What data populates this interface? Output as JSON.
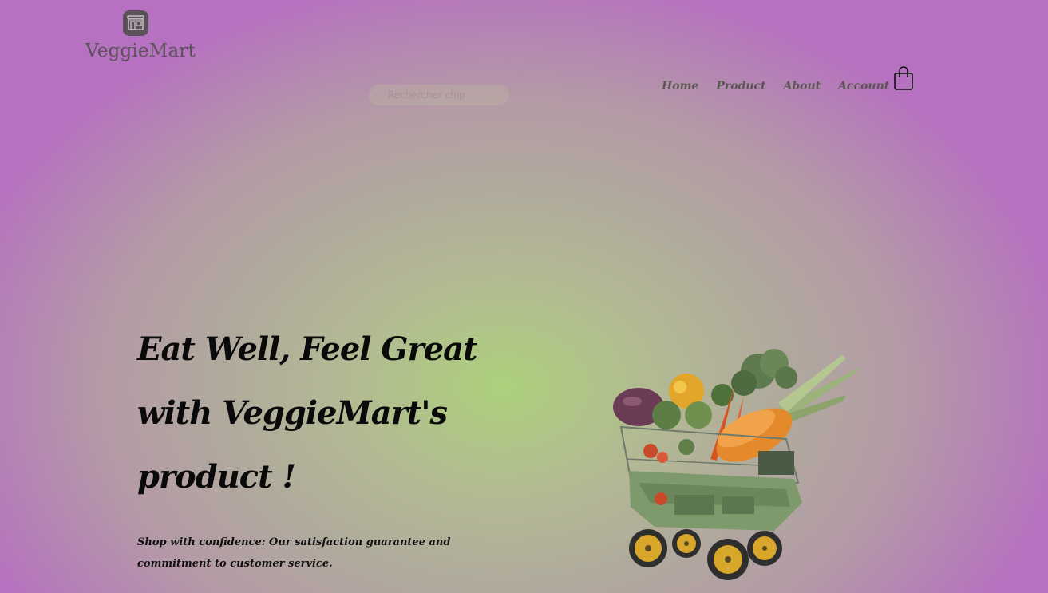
{
  "brand": {
    "name": "VeggieMart",
    "icon": "storefront-icon"
  },
  "search": {
    "placeholder": "Rechercher chip",
    "icon": "search-icon"
  },
  "nav": {
    "items": [
      {
        "label": "Home"
      },
      {
        "label": "Product"
      },
      {
        "label": "About"
      },
      {
        "label": "Account"
      }
    ],
    "cart_icon": "shopping-bag-icon"
  },
  "hero": {
    "title_lines": [
      "Eat Well, Feel Great",
      "with VeggieMart's",
      "product !"
    ],
    "subtitle_lines": [
      "Shop with confidence: Our satisfaction guarantee and",
      "commitment to customer service."
    ],
    "image": "vegetable-cart-illustration"
  },
  "colors": {
    "text_dark": "#0a0a0a",
    "nav_text": "#5a5752",
    "logo": "#5a5258",
    "bg_center": "#acd07c",
    "bg_edge": "#b671c0"
  }
}
